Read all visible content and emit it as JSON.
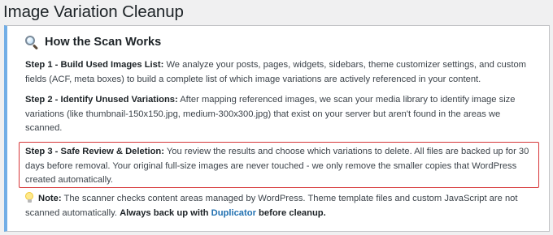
{
  "page": {
    "title": "Image Variation Cleanup"
  },
  "card": {
    "heading": "How the Scan Works",
    "heading_icon": "magnifier-icon",
    "accent_color": "#72aee6",
    "steps": [
      {
        "title": "Step 1 - Build Used Images List:",
        "text": " We analyze your posts, pages, widgets, sidebars, theme customizer settings, and custom fields (ACF, meta boxes) to build a complete list of which image variations are actively referenced in your content."
      },
      {
        "title": "Step 2 - Identify Unused Variations:",
        "text": " After mapping referenced images, we scan your media library to identify image size variations (like thumbnail-150x150.jpg, medium-300x300.jpg) that exist on your server but aren't found in the areas we scanned."
      },
      {
        "title": "Step 3 - Safe Review & Deletion:",
        "text": " You review the results and choose which variations to delete. All files are backed up for 30 days before removal. Your original full-size images are never touched - we only remove the smaller copies that WordPress created automatically.",
        "highlight_color": "#d63638"
      }
    ],
    "note": {
      "icon": "lightbulb-icon",
      "label": "Note:",
      "text": " The scanner checks content areas managed by WordPress. Theme template files and custom JavaScript are not scanned automatically. ",
      "strong_prefix": "Always back up with ",
      "link_label": "Duplicator",
      "strong_suffix": " before cleanup."
    }
  }
}
